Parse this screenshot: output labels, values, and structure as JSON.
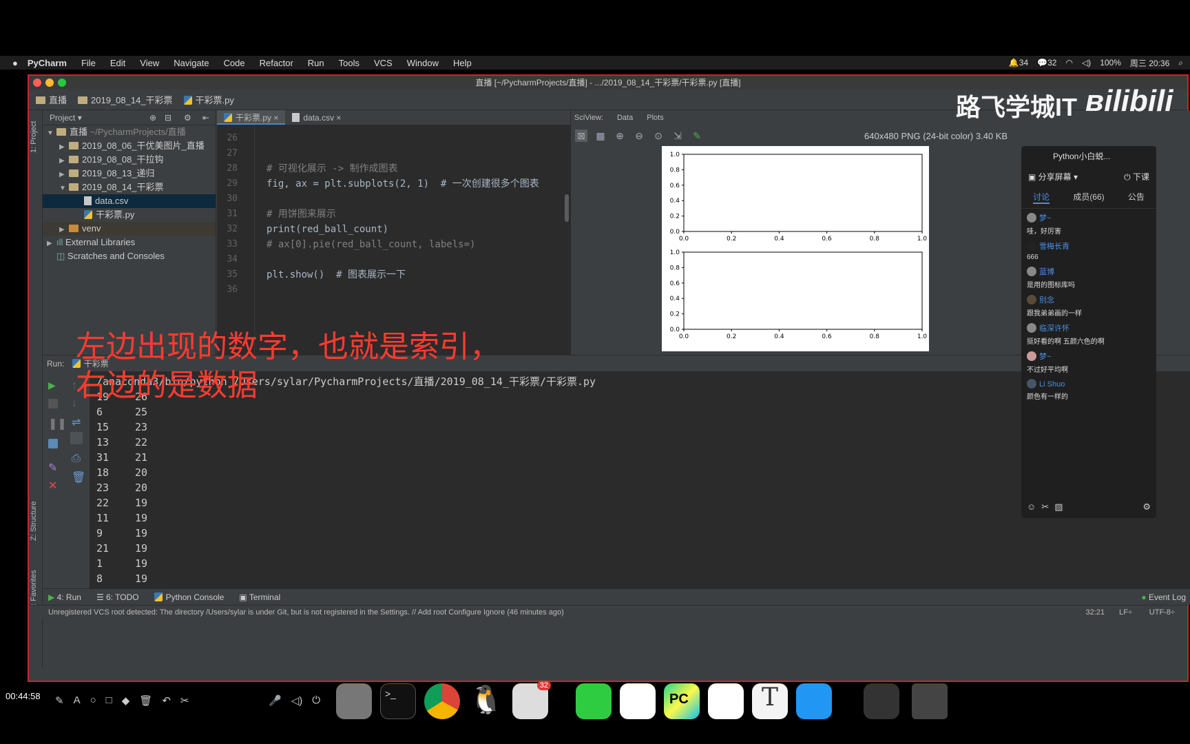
{
  "menubar": {
    "app": "PyCharm",
    "items": [
      "File",
      "Edit",
      "View",
      "Navigate",
      "Code",
      "Refactor",
      "Run",
      "Tools",
      "VCS",
      "Window",
      "Help"
    ],
    "status": {
      "notif_count": "34",
      "wechat_count": "32",
      "battery": "100%",
      "datetime": "周三 20:36"
    }
  },
  "window": {
    "title": "直播 [~/PycharmProjects/直播] - .../2019_08_14_干彩票/干彩票.py [直播]",
    "breadcrumb": [
      "直播",
      "2019_08_14_干彩票",
      "干彩票.py"
    ]
  },
  "sidebar_tabs": {
    "project": "1: Project",
    "structure": "Z: Structure",
    "favorites": "2: Favorites"
  },
  "project": {
    "header": "Project",
    "tree": [
      {
        "label": "直播",
        "suffix": "~/PycharmProjects/直播",
        "icon": "folder-icon",
        "expanded": true,
        "level": 0
      },
      {
        "label": "2019_08_06_干优美图片_直播",
        "icon": "folder-icon",
        "expanded": false,
        "level": 1
      },
      {
        "label": "2019_08_08_干拉钩",
        "icon": "folder-icon",
        "expanded": false,
        "level": 1
      },
      {
        "label": "2019_08_13_递归",
        "icon": "folder-icon",
        "expanded": false,
        "level": 1
      },
      {
        "label": "2019_08_14_干彩票",
        "icon": "folder-icon",
        "expanded": true,
        "level": 1
      },
      {
        "label": "data.csv",
        "icon": "csv-file-icon",
        "level": 2,
        "selected": true
      },
      {
        "label": "干彩票.py",
        "icon": "python-file-icon",
        "level": 2
      },
      {
        "label": "venv",
        "icon": "folder-icon",
        "expanded": false,
        "level": 1
      },
      {
        "label": "External Libraries",
        "icon": "library-icon",
        "expanded": false,
        "level": 0
      },
      {
        "label": "Scratches and Consoles",
        "icon": "scratch-icon",
        "level": 0
      }
    ]
  },
  "editor": {
    "tabs": [
      {
        "label": "干彩票.py",
        "active": true
      },
      {
        "label": "data.csv",
        "active": false
      }
    ],
    "lines": [
      {
        "n": "26",
        "code": ""
      },
      {
        "n": "27",
        "code": ""
      },
      {
        "n": "28",
        "code": "# 可视化展示 -> 制作成图表"
      },
      {
        "n": "29",
        "code": "fig, ax = plt.subplots(2, 1)  # 一次创建很多个图表"
      },
      {
        "n": "30",
        "code": ""
      },
      {
        "n": "31",
        "code": "# 用饼图来展示"
      },
      {
        "n": "32",
        "code": "print(red_ball_count)"
      },
      {
        "n": "33",
        "code": "# ax[0].pie(red_ball_count, labels=)"
      },
      {
        "n": "34",
        "code": ""
      },
      {
        "n": "35",
        "code": "plt.show()  # 图表展示一下"
      },
      {
        "n": "36",
        "code": ""
      }
    ]
  },
  "sciview": {
    "label": "SciView:",
    "tabs": [
      "Data",
      "Plots"
    ],
    "image_info": "640x480 PNG (24-bit color) 3.40 KB",
    "toolbar_icons": [
      "fit-icon",
      "grid-icon",
      "zoom-in-icon",
      "zoom-out-icon",
      "actual-size-icon",
      "export-icon",
      "color-picker-icon"
    ]
  },
  "chart_data": [
    {
      "type": "line",
      "title": "",
      "xlabel": "",
      "ylabel": "",
      "xlim": [
        0,
        1
      ],
      "ylim": [
        0,
        1
      ],
      "xticks": [
        "0.0",
        "0.2",
        "0.4",
        "0.6",
        "0.8",
        "1.0"
      ],
      "yticks": [
        "0.0",
        "0.2",
        "0.4",
        "0.6",
        "0.8",
        "1.0"
      ],
      "series": []
    },
    {
      "type": "line",
      "title": "",
      "xlabel": "",
      "ylabel": "",
      "xlim": [
        0,
        1
      ],
      "ylim": [
        0,
        1
      ],
      "xticks": [
        "0.0",
        "0.2",
        "0.4",
        "0.6",
        "0.8",
        "1.0"
      ],
      "yticks": [
        "0.0",
        "0.2",
        "0.4",
        "0.6",
        "0.8",
        "1.0"
      ],
      "series": []
    }
  ],
  "chat": {
    "title": "Python小白蜕...",
    "share": "分享屏幕",
    "end": "下课",
    "tabs": [
      "讨论",
      "成员(66)",
      "公告"
    ],
    "messages": [
      {
        "name": "梦~",
        "text": "哇，好厉害"
      },
      {
        "name": "雪梅长青",
        "text": "666"
      },
      {
        "name": "蓝博",
        "text": "是用的图标库吗"
      },
      {
        "name": "别念",
        "text": "跟我弟弟画的一样"
      },
      {
        "name": "临深许怀",
        "text": "挺好看的啊 五颜六色的啊"
      },
      {
        "name": "梦~",
        "text": "不过好平均啊"
      },
      {
        "name": "Li Shuo",
        "text": "颜色有一样的"
      }
    ]
  },
  "overlay": {
    "line1": "左边出现的数字，也就是索引，",
    "line2": "右边的是数据"
  },
  "watermark": {
    "text": "路飞学城IT",
    "logo": "bilibili"
  },
  "run": {
    "label": "Run:",
    "config": "干彩票",
    "command": "/anaconda3/bin/python /Users/sylar/PycharmProjects/直播/2019_08_14_干彩票/干彩票.py",
    "rows": [
      [
        "19",
        "26"
      ],
      [
        "6",
        "25"
      ],
      [
        "15",
        "23"
      ],
      [
        "13",
        "22"
      ],
      [
        "31",
        "21"
      ],
      [
        "18",
        "20"
      ],
      [
        "23",
        "20"
      ],
      [
        "22",
        "19"
      ],
      [
        "11",
        "19"
      ],
      [
        "9",
        "19"
      ],
      [
        "21",
        "19"
      ],
      [
        "1",
        "19"
      ],
      [
        "8",
        "19"
      ]
    ]
  },
  "bottom_tabs": [
    "4: Run",
    "6: TODO",
    "Python Console",
    "Terminal"
  ],
  "event_log": "Event Log",
  "statusbar": {
    "message": "Unregistered VCS root detected: The directory /Users/sylar is under Git, but is not registered in the Settings. // Add root  Configure  Ignore (46 minutes ago)",
    "position": "32:21",
    "line_sep": "LF÷",
    "encoding": "UTF-8÷"
  },
  "dock": {
    "timer": "00:44:58",
    "wechat_badge": "32"
  }
}
